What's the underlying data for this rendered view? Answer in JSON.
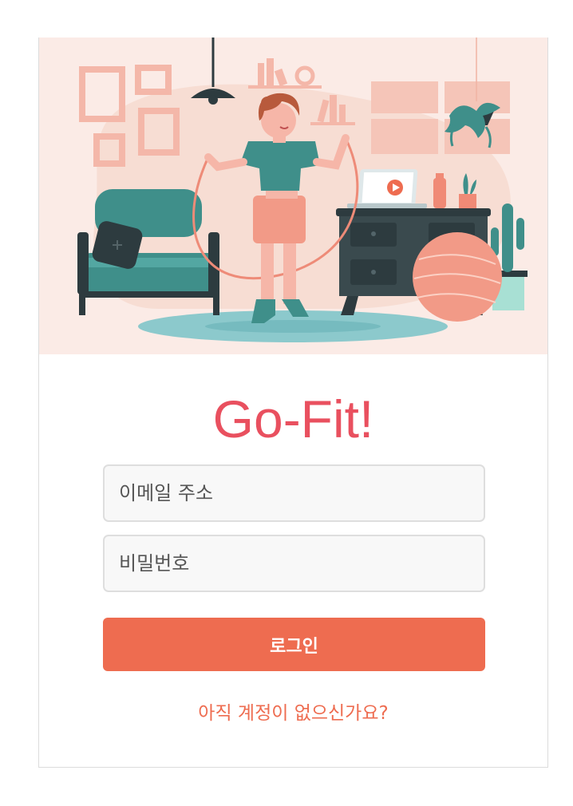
{
  "app": {
    "title": "Go-Fit!"
  },
  "hero": {
    "illustration": "woman-jumping-rope-living-room-illustration"
  },
  "form": {
    "email_placeholder": "이메일 주소",
    "email_value": "",
    "password_placeholder": "비밀번호",
    "password_value": "",
    "login_label": "로그인",
    "signup_link": "아직 계정이 없으신가요?"
  },
  "colors": {
    "title": "#e9505f",
    "accent": "#ee6c50",
    "hero_bg": "#fbebe6",
    "teal": "#3f8f8a"
  }
}
